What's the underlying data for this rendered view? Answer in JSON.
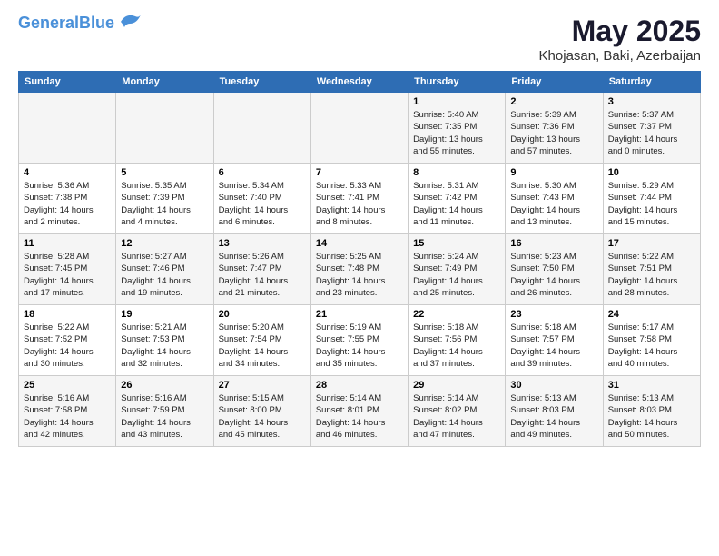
{
  "header": {
    "logo_line1": "General",
    "logo_line2": "Blue",
    "title": "May 2025",
    "subtitle": "Khojasan, Baki, Azerbaijan"
  },
  "days_of_week": [
    "Sunday",
    "Monday",
    "Tuesday",
    "Wednesday",
    "Thursday",
    "Friday",
    "Saturday"
  ],
  "weeks": [
    [
      {
        "day": "",
        "info": ""
      },
      {
        "day": "",
        "info": ""
      },
      {
        "day": "",
        "info": ""
      },
      {
        "day": "",
        "info": ""
      },
      {
        "day": "1",
        "info": "Sunrise: 5:40 AM\nSunset: 7:35 PM\nDaylight: 13 hours\nand 55 minutes."
      },
      {
        "day": "2",
        "info": "Sunrise: 5:39 AM\nSunset: 7:36 PM\nDaylight: 13 hours\nand 57 minutes."
      },
      {
        "day": "3",
        "info": "Sunrise: 5:37 AM\nSunset: 7:37 PM\nDaylight: 14 hours\nand 0 minutes."
      }
    ],
    [
      {
        "day": "4",
        "info": "Sunrise: 5:36 AM\nSunset: 7:38 PM\nDaylight: 14 hours\nand 2 minutes."
      },
      {
        "day": "5",
        "info": "Sunrise: 5:35 AM\nSunset: 7:39 PM\nDaylight: 14 hours\nand 4 minutes."
      },
      {
        "day": "6",
        "info": "Sunrise: 5:34 AM\nSunset: 7:40 PM\nDaylight: 14 hours\nand 6 minutes."
      },
      {
        "day": "7",
        "info": "Sunrise: 5:33 AM\nSunset: 7:41 PM\nDaylight: 14 hours\nand 8 minutes."
      },
      {
        "day": "8",
        "info": "Sunrise: 5:31 AM\nSunset: 7:42 PM\nDaylight: 14 hours\nand 11 minutes."
      },
      {
        "day": "9",
        "info": "Sunrise: 5:30 AM\nSunset: 7:43 PM\nDaylight: 14 hours\nand 13 minutes."
      },
      {
        "day": "10",
        "info": "Sunrise: 5:29 AM\nSunset: 7:44 PM\nDaylight: 14 hours\nand 15 minutes."
      }
    ],
    [
      {
        "day": "11",
        "info": "Sunrise: 5:28 AM\nSunset: 7:45 PM\nDaylight: 14 hours\nand 17 minutes."
      },
      {
        "day": "12",
        "info": "Sunrise: 5:27 AM\nSunset: 7:46 PM\nDaylight: 14 hours\nand 19 minutes."
      },
      {
        "day": "13",
        "info": "Sunrise: 5:26 AM\nSunset: 7:47 PM\nDaylight: 14 hours\nand 21 minutes."
      },
      {
        "day": "14",
        "info": "Sunrise: 5:25 AM\nSunset: 7:48 PM\nDaylight: 14 hours\nand 23 minutes."
      },
      {
        "day": "15",
        "info": "Sunrise: 5:24 AM\nSunset: 7:49 PM\nDaylight: 14 hours\nand 25 minutes."
      },
      {
        "day": "16",
        "info": "Sunrise: 5:23 AM\nSunset: 7:50 PM\nDaylight: 14 hours\nand 26 minutes."
      },
      {
        "day": "17",
        "info": "Sunrise: 5:22 AM\nSunset: 7:51 PM\nDaylight: 14 hours\nand 28 minutes."
      }
    ],
    [
      {
        "day": "18",
        "info": "Sunrise: 5:22 AM\nSunset: 7:52 PM\nDaylight: 14 hours\nand 30 minutes."
      },
      {
        "day": "19",
        "info": "Sunrise: 5:21 AM\nSunset: 7:53 PM\nDaylight: 14 hours\nand 32 minutes."
      },
      {
        "day": "20",
        "info": "Sunrise: 5:20 AM\nSunset: 7:54 PM\nDaylight: 14 hours\nand 34 minutes."
      },
      {
        "day": "21",
        "info": "Sunrise: 5:19 AM\nSunset: 7:55 PM\nDaylight: 14 hours\nand 35 minutes."
      },
      {
        "day": "22",
        "info": "Sunrise: 5:18 AM\nSunset: 7:56 PM\nDaylight: 14 hours\nand 37 minutes."
      },
      {
        "day": "23",
        "info": "Sunrise: 5:18 AM\nSunset: 7:57 PM\nDaylight: 14 hours\nand 39 minutes."
      },
      {
        "day": "24",
        "info": "Sunrise: 5:17 AM\nSunset: 7:58 PM\nDaylight: 14 hours\nand 40 minutes."
      }
    ],
    [
      {
        "day": "25",
        "info": "Sunrise: 5:16 AM\nSunset: 7:58 PM\nDaylight: 14 hours\nand 42 minutes."
      },
      {
        "day": "26",
        "info": "Sunrise: 5:16 AM\nSunset: 7:59 PM\nDaylight: 14 hours\nand 43 minutes."
      },
      {
        "day": "27",
        "info": "Sunrise: 5:15 AM\nSunset: 8:00 PM\nDaylight: 14 hours\nand 45 minutes."
      },
      {
        "day": "28",
        "info": "Sunrise: 5:14 AM\nSunset: 8:01 PM\nDaylight: 14 hours\nand 46 minutes."
      },
      {
        "day": "29",
        "info": "Sunrise: 5:14 AM\nSunset: 8:02 PM\nDaylight: 14 hours\nand 47 minutes."
      },
      {
        "day": "30",
        "info": "Sunrise: 5:13 AM\nSunset: 8:03 PM\nDaylight: 14 hours\nand 49 minutes."
      },
      {
        "day": "31",
        "info": "Sunrise: 5:13 AM\nSunset: 8:03 PM\nDaylight: 14 hours\nand 50 minutes."
      }
    ]
  ]
}
